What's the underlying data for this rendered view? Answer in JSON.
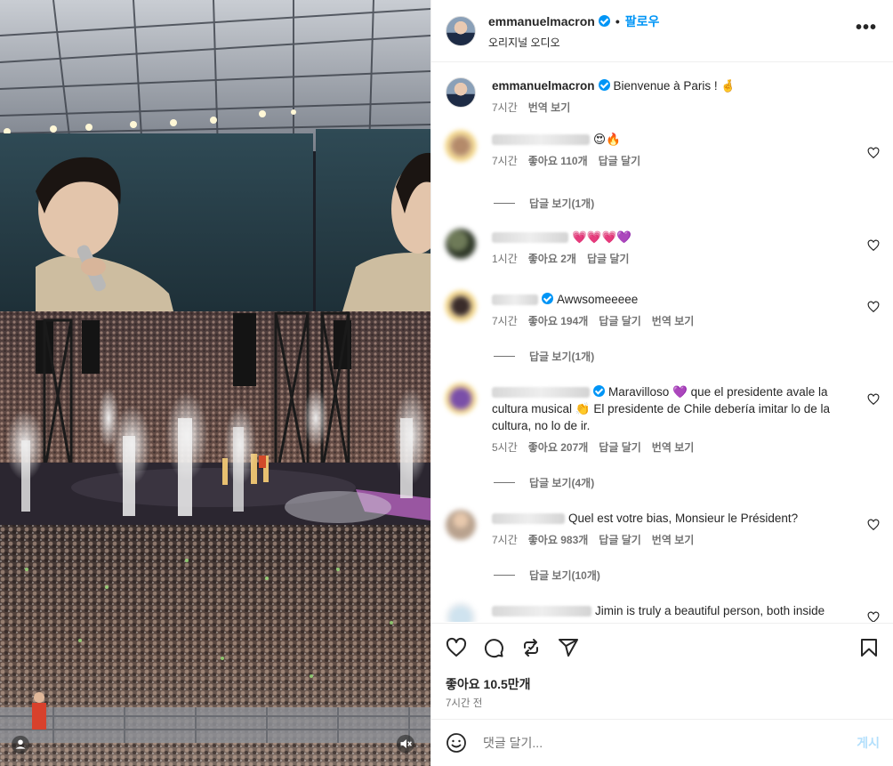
{
  "post": {
    "username": "emmanuelmacron",
    "follow_label": "팔로우",
    "audio_label": "오리지널 오디오",
    "more_label": "•••"
  },
  "caption": {
    "username": "emmanuelmacron",
    "text": "Bienvenue à Paris !",
    "time": "7시간",
    "translate": "번역 보기"
  },
  "comments": [
    {
      "text": "😍🔥",
      "time": "7시간",
      "likes": "좋아요 110개",
      "reply": "답글 달기",
      "replies": "답글 보기(1개)"
    },
    {
      "text": "💗💗💗💜",
      "time": "1시간",
      "likes": "좋아요 2개",
      "reply": "답글 달기"
    },
    {
      "text": "Awwsomeeeee",
      "time": "7시간",
      "likes": "좋아요 194개",
      "reply": "답글 달기",
      "translate": "번역 보기",
      "replies": "답글 보기(1개)"
    },
    {
      "text_a": "Maravilloso",
      "emoji_a": "💜",
      "text_b": "que el presidente avale la cultura musical",
      "emoji_b": "👏",
      "text_c": "El presidente de Chile debería imitar lo de la cultura, no lo de ir.",
      "time": "5시간",
      "likes": "좋아요 207개",
      "reply": "답글 달기",
      "translate": "번역 보기",
      "replies": "답글 보기(4개)"
    },
    {
      "text": "Quel est votre bias, Monsieur le Président?",
      "time": "7시간",
      "likes": "좋아요 983개",
      "reply": "답글 달기",
      "translate": "번역 보기",
      "replies": "답글 보기(10개)"
    },
    {
      "text": "Jimin is truly a beautiful person, both inside"
    }
  ],
  "actions": {
    "likes": "좋아요 10.5만개",
    "time_ago": "7시간 전"
  },
  "compose": {
    "placeholder": "댓글 달기...",
    "post_label": "게시"
  },
  "icons": {
    "more": "more-horizontal-icon",
    "like": "heart-icon",
    "comment": "comment-icon",
    "repost": "repost-icon",
    "share": "share-icon",
    "save": "bookmark-icon",
    "emoji": "smiley-icon",
    "mute": "speaker-muted-icon",
    "tag": "person-tag-icon"
  },
  "colors": {
    "verified": "#0095f6",
    "follow": "#0095f6",
    "post_disabled": "#b2dffc",
    "meta_text": "#737373"
  }
}
